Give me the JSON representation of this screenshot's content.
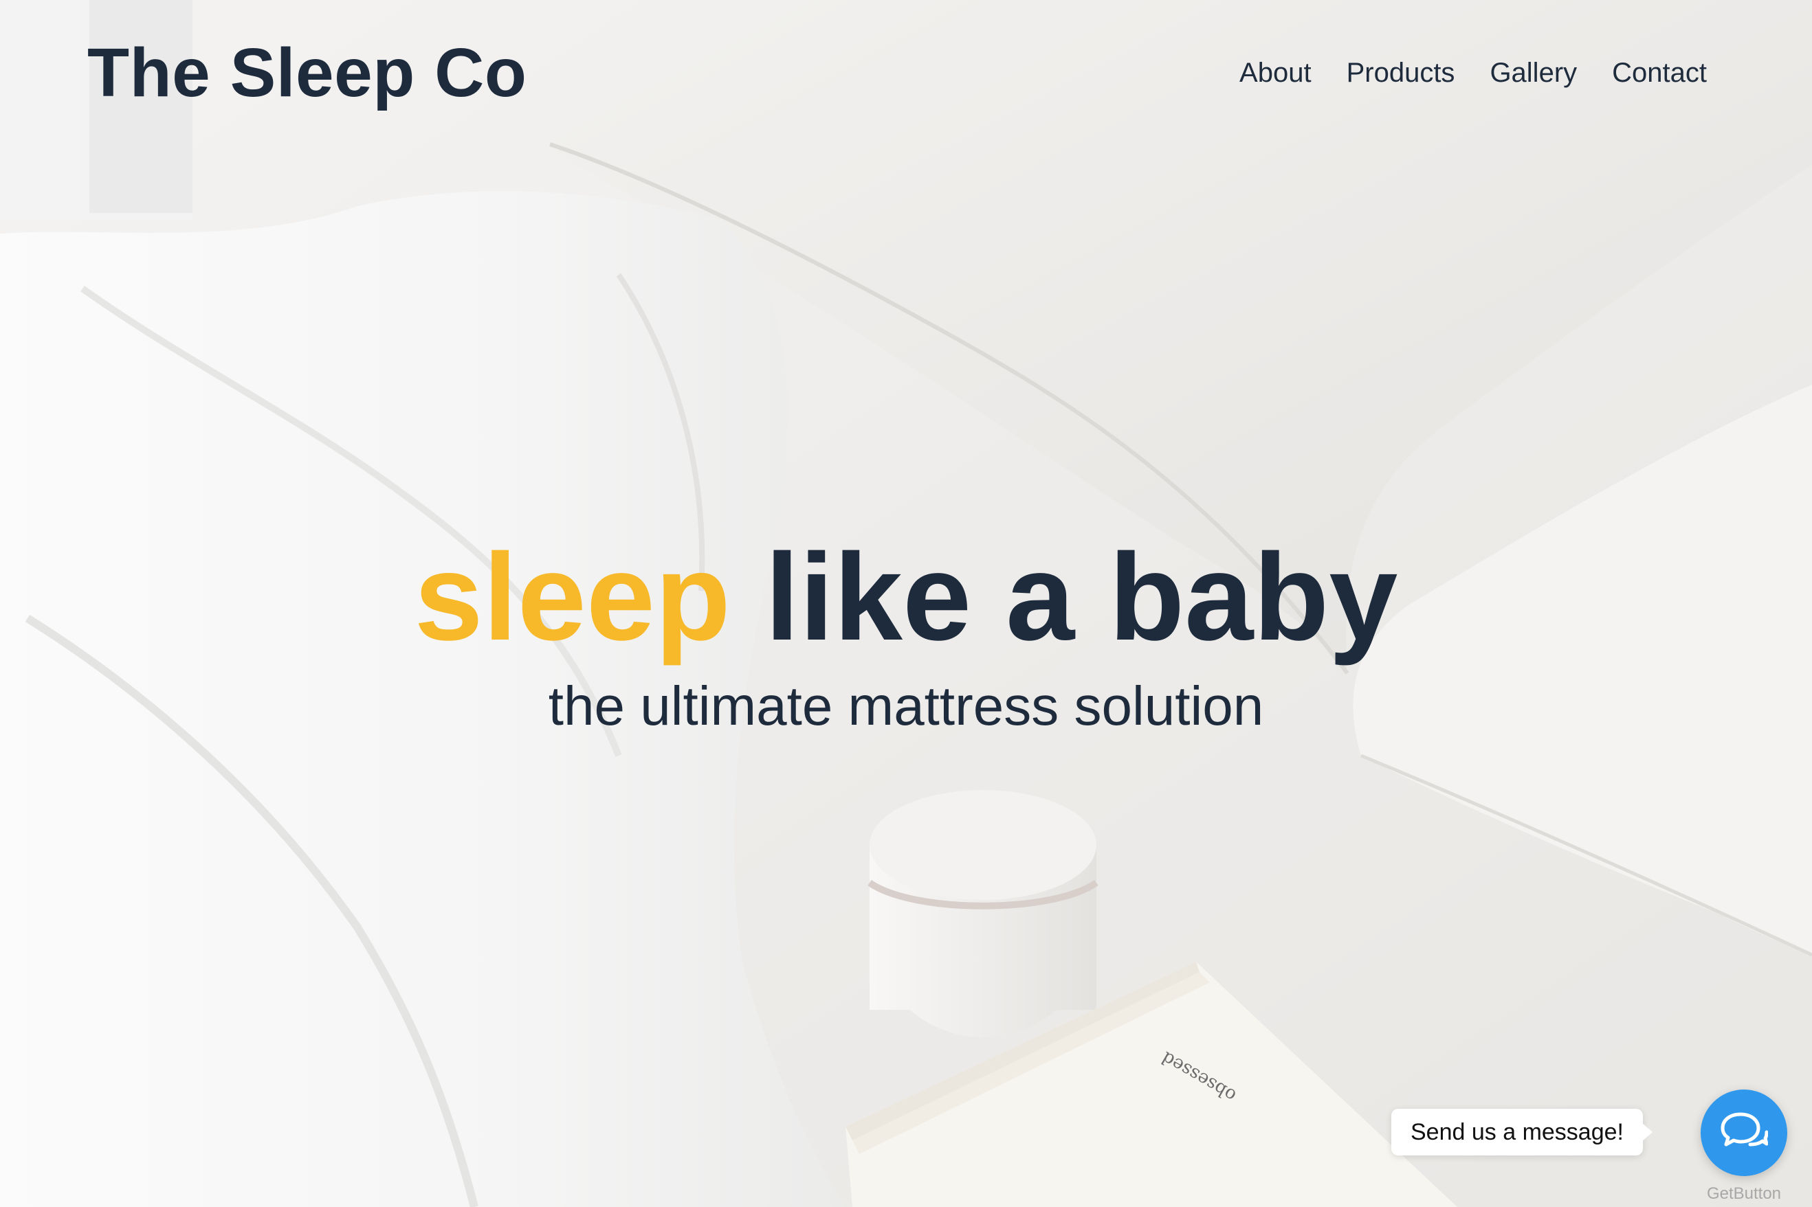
{
  "brand": {
    "name": "The Sleep Co"
  },
  "nav": {
    "items": [
      {
        "label": "About"
      },
      {
        "label": "Products"
      },
      {
        "label": "Gallery"
      },
      {
        "label": "Contact"
      }
    ]
  },
  "hero": {
    "headline_accent": "sleep",
    "headline_rest": " like a baby",
    "subheadline": "the ultimate mattress solution",
    "book_text": "obsessed"
  },
  "chat_widget": {
    "bubble_text": "Send us a message!",
    "icon": "chat-bubbles-icon",
    "powered_by": "GetButton"
  },
  "colors": {
    "text_dark": "#1e2b3c",
    "accent": "#f7b92a",
    "chat_button": "#2f98ec"
  }
}
